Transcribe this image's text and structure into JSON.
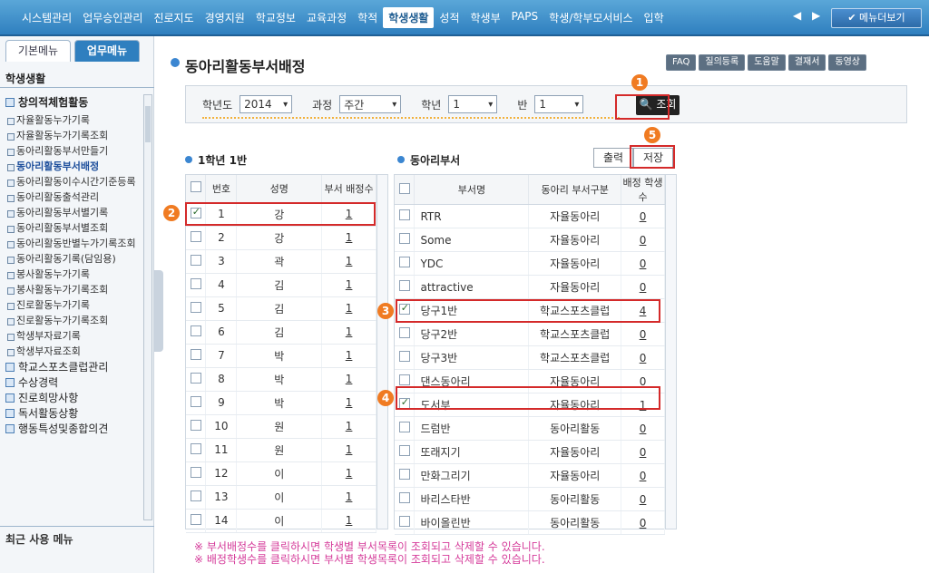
{
  "topnav": {
    "items": [
      "시스템관리",
      "업무승인관리",
      "진로지도",
      "경영지원",
      "학교정보",
      "교육과정",
      "학적",
      "학생생활",
      "성적",
      "학생부",
      "PAPS",
      "학생/학부모서비스",
      "입학"
    ],
    "active_index": 7,
    "arrows": "◀ ▶",
    "more_label": "메뉴더보기"
  },
  "sidebar": {
    "tabs": [
      "기본메뉴",
      "업무메뉴"
    ],
    "active_tab": 1,
    "title": "학생생활",
    "section": "창의적체험활동",
    "items": [
      "자율활동누가기록",
      "자율활동누가기록조회",
      "동아리활동부서만들기",
      "동아리활동부서배정",
      "동아리활동이수시간기준등록",
      "동아리활동출석관리",
      "동아리활동부서별기록",
      "동아리활동부서별조회",
      "동아리활동반별누가기록조회",
      "동아리활동기록(담임용)",
      "봉사활동누가기록",
      "봉사활동누가기록조회",
      "진로활동누가기록",
      "진로활동누가기록조회",
      "학생부자료기록",
      "학생부자료조회"
    ],
    "active_item": 3,
    "groups": [
      "학교스포츠클럽관리",
      "수상경력",
      "진로희망사항",
      "독서활동상황",
      "행동특성및종합의견"
    ],
    "recent_title": "최근 사용 메뉴"
  },
  "main": {
    "title": "동아리활동부서배정",
    "top_buttons": [
      "FAQ",
      "질의등록",
      "도움말",
      "결재서",
      "동영상"
    ],
    "filter": {
      "year_label": "학년도",
      "year_value": "2014",
      "course_label": "과정",
      "course_value": "주간",
      "grade_label": "학년",
      "grade_value": "1",
      "class_label": "반",
      "class_value": "1",
      "query_label": "조회"
    },
    "left_grid": {
      "title": "1학년 1반",
      "headers": [
        "번호",
        "성명",
        "부서 배정수"
      ],
      "rows": [
        {
          "no": "1",
          "name": "강",
          "count": "1",
          "checked": true
        },
        {
          "no": "2",
          "name": "강",
          "count": "1",
          "checked": false
        },
        {
          "no": "3",
          "name": "곽",
          "count": "1",
          "checked": false
        },
        {
          "no": "4",
          "name": "김",
          "count": "1",
          "checked": false
        },
        {
          "no": "5",
          "name": "김",
          "count": "1",
          "checked": false
        },
        {
          "no": "6",
          "name": "김",
          "count": "1",
          "checked": false
        },
        {
          "no": "7",
          "name": "박",
          "count": "1",
          "checked": false
        },
        {
          "no": "8",
          "name": "박",
          "count": "1",
          "checked": false
        },
        {
          "no": "9",
          "name": "박",
          "count": "1",
          "checked": false
        },
        {
          "no": "10",
          "name": "원",
          "count": "1",
          "checked": false
        },
        {
          "no": "11",
          "name": "원",
          "count": "1",
          "checked": false
        },
        {
          "no": "12",
          "name": "이",
          "count": "1",
          "checked": false
        },
        {
          "no": "13",
          "name": "이",
          "count": "1",
          "checked": false
        },
        {
          "no": "14",
          "name": "이",
          "count": "1",
          "checked": false
        }
      ]
    },
    "right_grid": {
      "title": "동아리부서",
      "print_label": "출력",
      "save_label": "저장",
      "headers": [
        "부서명",
        "동아리 부서구분",
        "배정 학생수"
      ],
      "rows": [
        {
          "name": "RTR",
          "type": "자율동아리",
          "count": "0",
          "checked": false
        },
        {
          "name": "Some",
          "type": "자율동아리",
          "count": "0",
          "checked": false
        },
        {
          "name": "YDC",
          "type": "자율동아리",
          "count": "0",
          "checked": false
        },
        {
          "name": "attractive",
          "type": "자율동아리",
          "count": "0",
          "checked": false
        },
        {
          "name": "당구1반",
          "type": "학교스포츠클럽",
          "count": "4",
          "checked": true
        },
        {
          "name": "당구2반",
          "type": "학교스포츠클럽",
          "count": "0",
          "checked": false
        },
        {
          "name": "당구3반",
          "type": "학교스포츠클럽",
          "count": "0",
          "checked": false
        },
        {
          "name": "댄스동아리",
          "type": "자율동아리",
          "count": "0",
          "checked": false
        },
        {
          "name": "도서부",
          "type": "자율동아리",
          "count": "1",
          "checked": true
        },
        {
          "name": "드럼반",
          "type": "동아리활동",
          "count": "0",
          "checked": false
        },
        {
          "name": "또래지기",
          "type": "자율동아리",
          "count": "0",
          "checked": false
        },
        {
          "name": "만화그리기",
          "type": "자율동아리",
          "count": "0",
          "checked": false
        },
        {
          "name": "바리스타반",
          "type": "동아리활동",
          "count": "0",
          "checked": false
        },
        {
          "name": "바이올린반",
          "type": "동아리활동",
          "count": "0",
          "checked": false
        }
      ]
    },
    "notes": [
      "※ 부서배정수를 클릭하시면 학생별 부서목록이 조회되고 삭제할 수 있습니다.",
      "※ 배정학생수를 클릭하시면 부서별 학생목록이 조회되고 삭제할 수 있습니다."
    ],
    "markers": [
      "1",
      "2",
      "3",
      "4",
      "5"
    ]
  }
}
